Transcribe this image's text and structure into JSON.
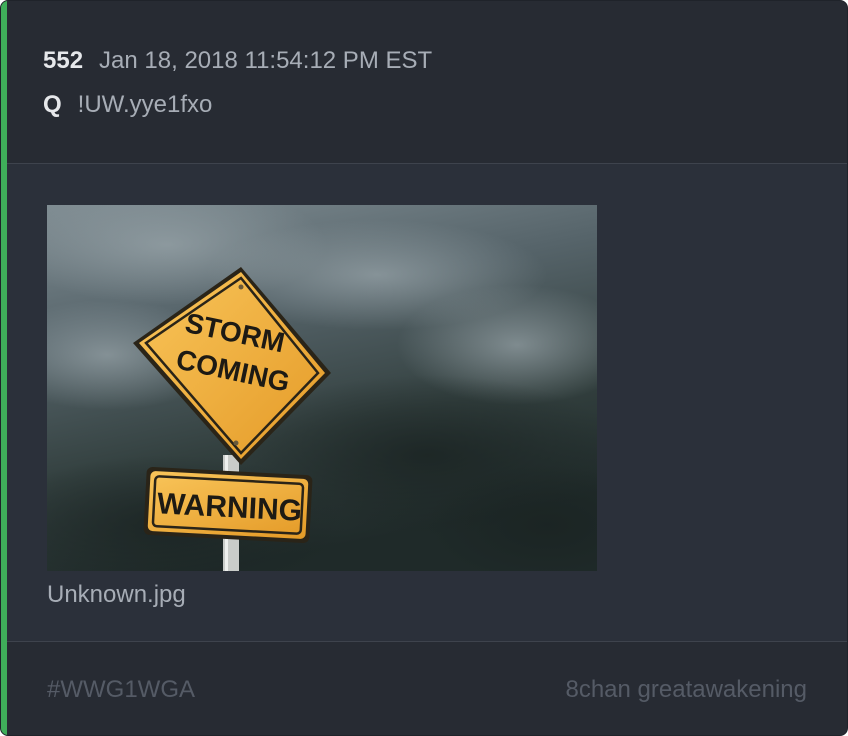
{
  "post": {
    "number": "552",
    "date": "Jan 18, 2018 11:54:12 PM EST",
    "author": "Q",
    "tripcode": "!UW.yye1fxo"
  },
  "attachment": {
    "filename": "Unknown.jpg",
    "image_text": {
      "diamond_line1": "STORM",
      "diamond_line2": "COMING",
      "rect_sign": "WARNING"
    }
  },
  "footer": {
    "hashtag": "#WWG1WGA",
    "source": "8chan greatawakening"
  },
  "colors": {
    "accent": "#3fae5a",
    "card_bg": "#2b303a",
    "sign_yellow": "#f4b13c"
  }
}
